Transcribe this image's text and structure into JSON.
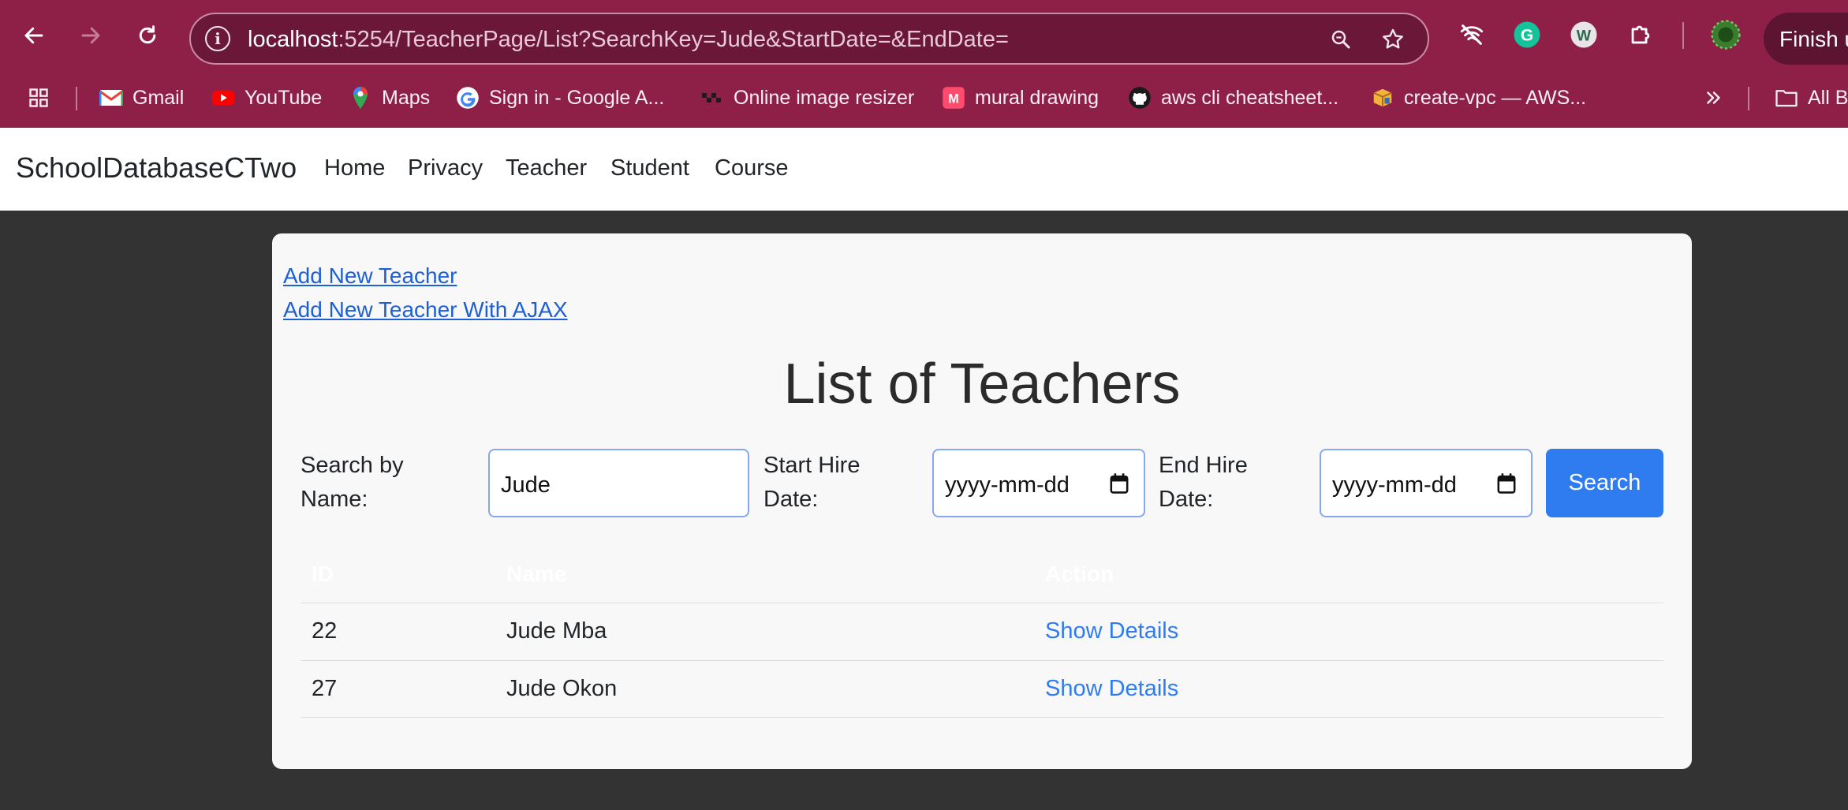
{
  "browser": {
    "url_host": "localhost",
    "url_path": ":5254/TeacherPage/List?SearchKey=Jude&StartDate=&EndDate=",
    "finish_label": "Finish u",
    "bookmarks": [
      {
        "label": "Gmail",
        "icon": "gmail-icon"
      },
      {
        "label": "YouTube",
        "icon": "youtube-icon"
      },
      {
        "label": "Maps",
        "icon": "maps-icon"
      },
      {
        "label": "Sign in - Google A...",
        "icon": "google-icon"
      },
      {
        "label": "Online image resizer",
        "icon": "resizer-icon"
      },
      {
        "label": "mural drawing",
        "icon": "mural-icon"
      },
      {
        "label": "aws cli cheatsheet...",
        "icon": "github-icon"
      },
      {
        "label": "create-vpc — AWS...",
        "icon": "aws-icon"
      },
      {
        "label": "All B",
        "icon": "folder-icon"
      }
    ]
  },
  "navbar": {
    "brand": "SchoolDatabaseCTwo",
    "links": [
      "Home",
      "Privacy",
      "Teacher",
      "Student",
      "Course"
    ]
  },
  "page": {
    "add_link": "Add New Teacher",
    "add_ajax_link": "Add New Teacher With AJAX",
    "title": "List of Teachers",
    "search": {
      "name_label_line1": "Search by",
      "name_label_line2": "Name:",
      "name_value": "Jude",
      "start_label_line1": "Start Hire",
      "start_label_line2": "Date:",
      "start_value": "yyyy-mm-dd",
      "end_label_line1": "End Hire",
      "end_label_line2": "Date:",
      "end_value": "yyyy-mm-dd",
      "button": "Search"
    },
    "table": {
      "headers": [
        "ID",
        "Name",
        "Action"
      ],
      "rows": [
        {
          "id": "22",
          "name": "Jude Mba",
          "action": "Show Details"
        },
        {
          "id": "27",
          "name": "Jude Okon",
          "action": "Show Details"
        }
      ]
    }
  },
  "colors": {
    "chrome": "#8e2048",
    "page_bg": "#333333",
    "link": "#1d5fd6",
    "button": "#2f7bf0"
  }
}
